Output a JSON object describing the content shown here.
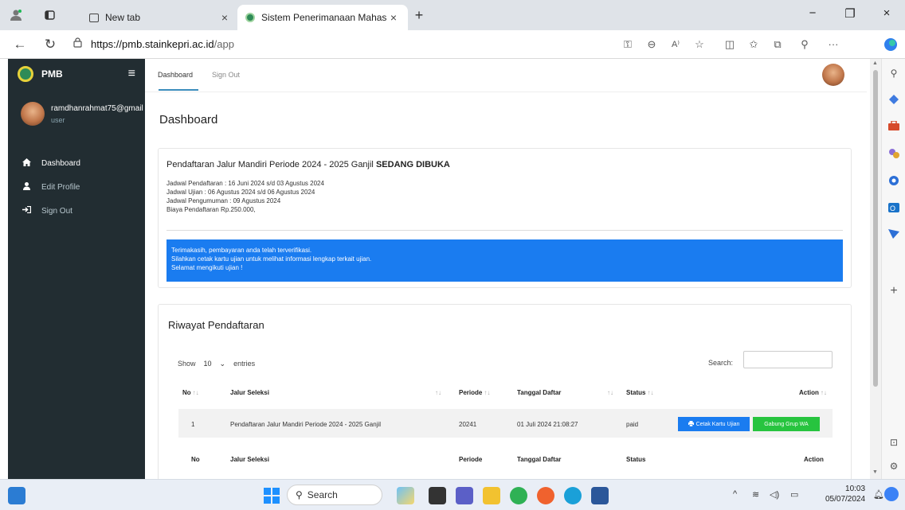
{
  "browser": {
    "tabs": [
      {
        "title": "New tab",
        "active": false
      },
      {
        "title": "Sistem Penerimanaan Mahasiswa",
        "active": true
      }
    ],
    "new_tab_symbol": "+",
    "close_symbol": "×",
    "url_scheme_host": "https://pmb.stainkepri.ac.id",
    "url_path": "/app",
    "window_controls": {
      "minimize": "−",
      "maximize": "❐",
      "close": "×"
    },
    "toolbar_icons": [
      "key-icon",
      "zoom-icon",
      "read-aloud-icon",
      "favorite-icon",
      "split-screen-icon",
      "favorites-bar-icon",
      "collections-icon",
      "extensions-icon",
      "more-icon"
    ]
  },
  "sidebar": {
    "brand": "PMB",
    "user_name": "ramdhanrahmat75@gmail",
    "user_role": "user",
    "items": [
      {
        "label": "Dashboard",
        "icon": "home-icon",
        "active": true
      },
      {
        "label": "Edit Profile",
        "icon": "user-icon",
        "active": false
      },
      {
        "label": "Sign Out",
        "icon": "sign-out-icon",
        "active": false
      }
    ]
  },
  "topnav": {
    "links": [
      "Dashboard",
      "Sign Out"
    ]
  },
  "page": {
    "title": "Dashboard"
  },
  "info": {
    "title_prefix": "Pendaftaran Jalur Mandiri Periode 2024 - 2025 Ganjil",
    "title_status": "SEDANG DIBUKA",
    "lines": [
      "Jadwal Pendaftaran : 16 Juni 2024 s/d 03 Agustus 2024",
      "Jadwal Ujian : 06 Agustus 2024 s/d 06 Agustus 2024",
      "Jadwal Pengumuman : 09 Agustus 2024",
      "Biaya Pendaftaran Rp.250.000,"
    ],
    "alert_lines": [
      "Terimakasih, pembayaran anda telah terverifikasi.",
      "Silahkan cetak kartu ujian untuk melihat informasi lengkap terkait ujian.",
      "Selamat mengikuti ujian !"
    ]
  },
  "history": {
    "title": "Riwayat Pendaftaran",
    "show_label": "Show",
    "entries_value": "10",
    "entries_label": "entries",
    "search_label": "Search:",
    "search_value": "",
    "columns": [
      "No",
      "Jalur Seleksi",
      "Periode",
      "Tanggal Daftar",
      "Status",
      "Action"
    ],
    "rows": [
      {
        "no": "1",
        "jalur": "Pendaftaran Jalur Mandiri Periode 2024 - 2025 Ganjil",
        "periode": "20241",
        "tanggal": "01 Juli 2024 21:08:27",
        "status": "paid"
      }
    ],
    "action_print": "Cetak Kartu Ujian",
    "action_join": "Gabung Grup WA"
  },
  "taskbar": {
    "search_placeholder": "Search",
    "time": "10:03",
    "date": "05/07/2024"
  },
  "colors": {
    "sidebar_bg": "#222d32",
    "accent_blue": "#1a7cf0",
    "accent_green": "#27c43f",
    "link_underline": "#3c8dbc"
  }
}
